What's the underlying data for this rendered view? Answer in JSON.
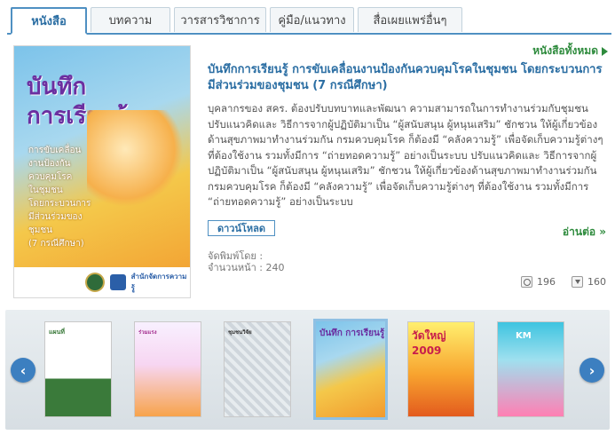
{
  "tabs": [
    {
      "label": "หนังสือ",
      "active": true
    },
    {
      "label": "บทความ",
      "active": false
    },
    {
      "label": "วารสารวิชาการ",
      "active": false
    },
    {
      "label": "คู่มือ/แนวทาง",
      "active": false
    },
    {
      "label": "สื่อเผยแพร่อื่นๆ",
      "active": false
    }
  ],
  "all_books_label": "หนังสือทั้งหมด",
  "featured": {
    "cover": {
      "title_line1": "บันทึก",
      "title_line2": "การเรียนรู้..",
      "sub_lines": [
        "การขับเคลื่อน",
        "งานป้องกัน",
        "ควบคุมโรค",
        "ในชุมชน",
        "โดยกระบวนการ",
        "มีส่วนร่วมของ",
        "ชุมชน",
        "(7 กรณีศึกษา)"
      ],
      "footer_text": "สำนักจัดการความรู้"
    },
    "title": "บันทึกการเรียนรู้ การขับเคลื่อนงานป้องกันควบคุมโรคในชุมชน โดยกระบวนการมีส่วนร่วมของชุมชน (7 กรณีศึกษา)",
    "description": "บุคลากรของ สคร. ต้องปรับบทบาทและพัฒนา ความสามารถในการทำงานร่วมกับชุมชน ปรับแนวคิดและ วิธีการจากผู้ปฏิบัติมาเป็น “ผู้สนับสนุน ผู้หนุนเสริม” ชักชวน ให้ผู้เกี่ยวข้องด้านสุขภาพมาทำงานร่วมกัน กรมควบคุมโรค ก็ต้องมี “คลังความรู้” เพื่อจัดเก็บความรู้ต่างๆ ที่ต้องใช้งาน รวมทั้งมีการ “ถ่ายทอดความรู้” อย่างเป็นระบบ ปรับแนวคิดและ วิธีการจากผู้ปฏิบัติมาเป็น “ผู้สนับสนุน ผู้หนุนเสริม” ชักชวน ให้ผู้เกี่ยวข้องด้านสุขภาพมาทำงานร่วมกัน กรมควบคุมโรค ก็ต้องมี “คลังความรู้” เพื่อจัดเก็บความรู้ต่างๆ ที่ต้องใช้งาน รวมทั้งมีการ “ถ่ายทอดความรู้” อย่างเป็นระบบ",
    "download_label": "ดาวน์โหลด",
    "read_more_label": "อ่านต่อ »",
    "publisher_label": "จัดพิมพ์โดย :",
    "pages_label": "จำนวนหน้า : 240",
    "views": "196",
    "downloads": "160"
  },
  "carousel": {
    "prev_label": "‹",
    "next_label": "›",
    "thumbs": [
      {
        "label": "แผนที่"
      },
      {
        "label": "ร่วมแรง"
      },
      {
        "label": "ชุมชนวิจัย"
      },
      {
        "label": "บันทึก การเรียนรู้"
      },
      {
        "label": "วัดใหญ่ 2009"
      },
      {
        "label": "KM"
      }
    ]
  },
  "colors": {
    "accent": "#4f90c2",
    "link": "#2b6ea3",
    "green": "#2e8b3d"
  }
}
